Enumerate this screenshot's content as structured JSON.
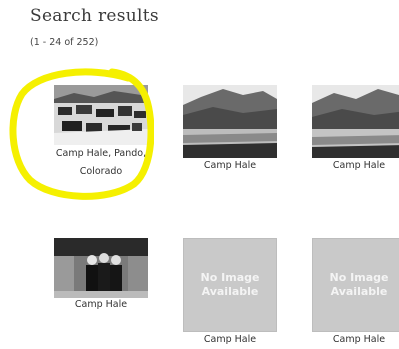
{
  "page": {
    "title": "Search results",
    "count": "(1 - 24 of 252)"
  },
  "results": [
    {
      "caption_line1": "Camp Hale, Pando,",
      "caption_line2": "Colorado",
      "image": "photo-snowy-buildings"
    },
    {
      "caption": "Camp Hale",
      "image": "photo-valley-mountains"
    },
    {
      "caption": "Camp Hale",
      "image": "photo-valley-mountains"
    },
    {
      "caption": "Camp Hale",
      "image": "photo-group-people"
    },
    {
      "caption": "Camp Hale",
      "image": "no-image-placeholder",
      "placeholder_line1": "No Image",
      "placeholder_line2": "Available"
    },
    {
      "caption": "Camp Hale",
      "image": "no-image-placeholder",
      "placeholder_line1": "No Image",
      "placeholder_line2": "Available"
    }
  ],
  "annotation": {
    "color": "#f5f000"
  }
}
